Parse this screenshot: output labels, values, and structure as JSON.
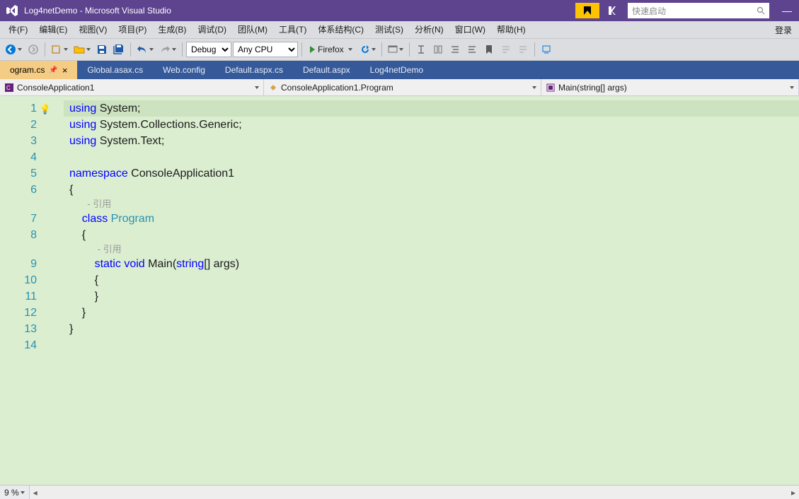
{
  "title": "Log4netDemo - Microsoft Visual Studio",
  "search_placeholder": "快速启动",
  "login_label": "登录",
  "menu": [
    "件(F)",
    "编辑(E)",
    "视图(V)",
    "项目(P)",
    "生成(B)",
    "调试(D)",
    "团队(M)",
    "工具(T)",
    "体系结构(C)",
    "测试(S)",
    "分析(N)",
    "窗口(W)",
    "帮助(H)"
  ],
  "toolbar": {
    "config": "Debug",
    "platform": "Any CPU",
    "browser": "Firefox"
  },
  "tabs": [
    {
      "label": "ogram.cs",
      "active": true,
      "pinned": true,
      "close": true
    },
    {
      "label": "Global.asax.cs",
      "active": false
    },
    {
      "label": "Web.config",
      "active": false
    },
    {
      "label": "Default.aspx.cs",
      "active": false
    },
    {
      "label": "Default.aspx",
      "active": false
    },
    {
      "label": "Log4netDemo",
      "active": false
    }
  ],
  "nav": {
    "scope": "ConsoleApplication1",
    "type": "ConsoleApplication1.Program",
    "member": "Main(string[] args)"
  },
  "code": {
    "lines": [
      1,
      2,
      3,
      4,
      5,
      6,
      7,
      8,
      9,
      10,
      11,
      12,
      13,
      14
    ],
    "ref_label": "- 引用",
    "l1a": "using",
    "l1b": " System;",
    "l2a": "using",
    "l2b": " System.Collections.Generic;",
    "l3a": "using",
    "l3b": " System.Text;",
    "l5a": "namespace",
    "l5b": " ConsoleApplication1",
    "l6": "{",
    "l7a": "    class",
    "l7b": " Program",
    "l8": "    {",
    "l9a": "        static",
    "l9b": " void",
    "l9c": " Main(",
    "l9d": "string",
    "l9e": "[] args)",
    "l10": "        {",
    "l11": "        }",
    "l12": "    }",
    "l13": "}"
  },
  "zoom": "9 %"
}
